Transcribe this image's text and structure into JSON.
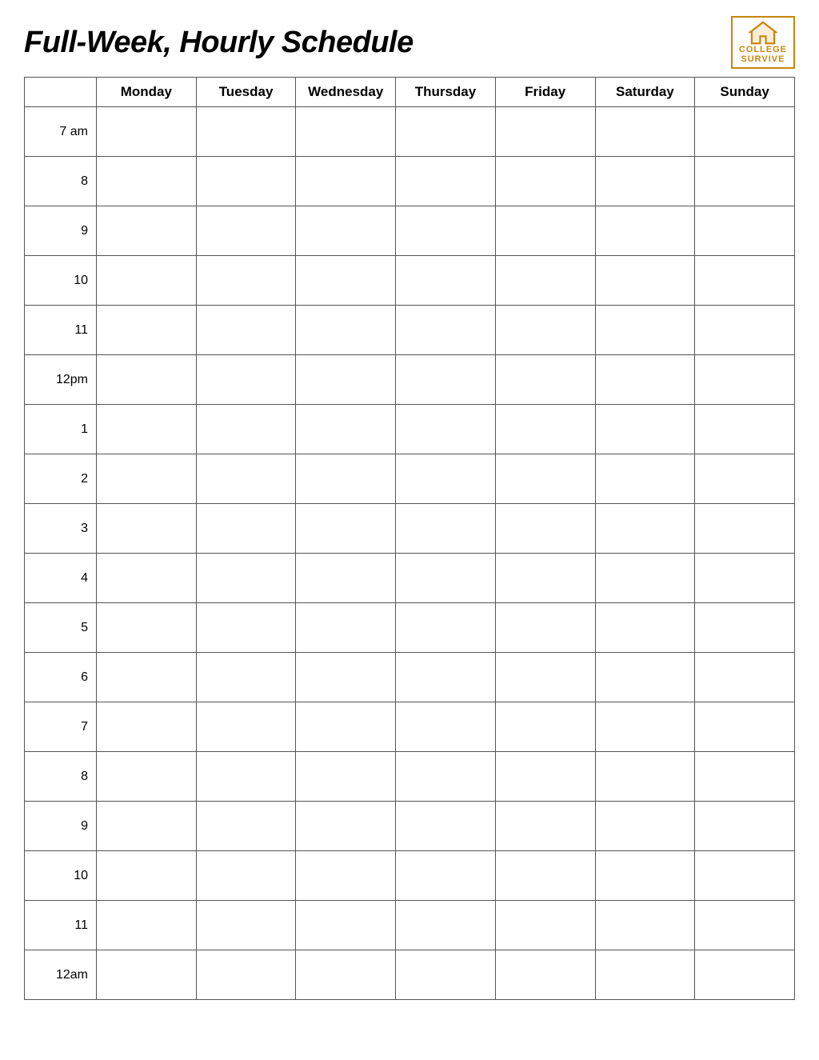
{
  "header": {
    "title": "Full-Week, Hourly Schedule",
    "logo": {
      "line1": "COLLEGE",
      "line2": "SURVIVE"
    }
  },
  "table": {
    "days": [
      "Monday",
      "Tuesday",
      "Wednesday",
      "Thursday",
      "Friday",
      "Saturday",
      "Sunday"
    ],
    "times": [
      "7 am",
      "8",
      "9",
      "10",
      "11",
      "12pm",
      "1",
      "2",
      "3",
      "4",
      "5",
      "6",
      "7",
      "8",
      "9",
      "10",
      "11",
      "12am"
    ]
  }
}
